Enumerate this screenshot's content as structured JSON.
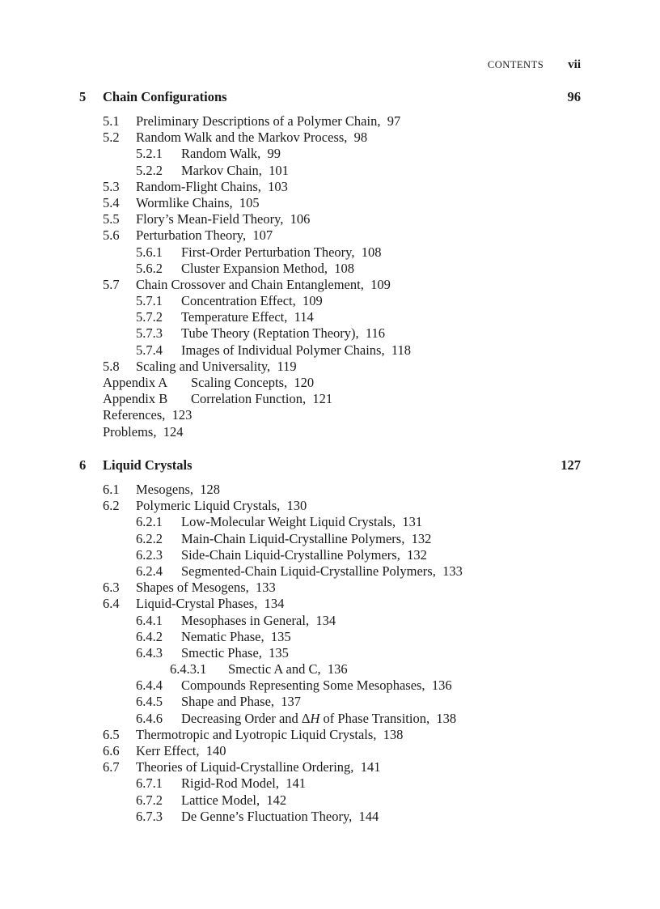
{
  "running_head": {
    "title": "CONTENTS",
    "page": "vii"
  },
  "chapters": [
    {
      "number": "5",
      "title": "Chain Configurations",
      "page": "96",
      "entries": [
        {
          "level": 1,
          "num": "5.1",
          "title": "Preliminary Descriptions of a Polymer Chain,",
          "page": "97"
        },
        {
          "level": 1,
          "num": "5.2",
          "title": "Random Walk and the Markov Process,",
          "page": "98"
        },
        {
          "level": 2,
          "num": "5.2.1",
          "title": "Random Walk,",
          "page": "99"
        },
        {
          "level": 2,
          "num": "5.2.2",
          "title": "Markov Chain,",
          "page": "101"
        },
        {
          "level": 1,
          "num": "5.3",
          "title": "Random-Flight Chains,",
          "page": "103"
        },
        {
          "level": 1,
          "num": "5.4",
          "title": "Wormlike Chains,",
          "page": "105"
        },
        {
          "level": 1,
          "num": "5.5",
          "title": "Flory’s Mean-Field Theory,",
          "page": "106"
        },
        {
          "level": 1,
          "num": "5.6",
          "title": "Perturbation Theory,",
          "page": "107"
        },
        {
          "level": 2,
          "num": "5.6.1",
          "title": "First-Order Perturbation Theory,",
          "page": "108"
        },
        {
          "level": 2,
          "num": "5.6.2",
          "title": "Cluster Expansion Method,",
          "page": "108"
        },
        {
          "level": 1,
          "num": "5.7",
          "title": "Chain Crossover and Chain Entanglement,",
          "page": "109"
        },
        {
          "level": 2,
          "num": "5.7.1",
          "title": "Concentration Effect,",
          "page": "109"
        },
        {
          "level": 2,
          "num": "5.7.2",
          "title": "Temperature Effect,",
          "page": "114"
        },
        {
          "level": 2,
          "num": "5.7.3",
          "title": "Tube Theory (Reptation Theory),",
          "page": "116"
        },
        {
          "level": 2,
          "num": "5.7.4",
          "title": "Images of Individual Polymer Chains,",
          "page": "118"
        },
        {
          "level": 1,
          "num": "5.8",
          "title": "Scaling and Universality,",
          "page": "119"
        },
        {
          "level": 0,
          "num": "Appendix A",
          "title": "Scaling Concepts,",
          "page": "120"
        },
        {
          "level": 0,
          "num": "Appendix B",
          "title": "Correlation Function,",
          "page": "121"
        },
        {
          "level": 0,
          "num": "",
          "title": "References,",
          "page": "123"
        },
        {
          "level": 0,
          "num": "",
          "title": "Problems,",
          "page": "124"
        }
      ]
    },
    {
      "number": "6",
      "title": "Liquid Crystals",
      "page": "127",
      "entries": [
        {
          "level": 1,
          "num": "6.1",
          "title": "Mesogens,",
          "page": "128"
        },
        {
          "level": 1,
          "num": "6.2",
          "title": "Polymeric Liquid Crystals,",
          "page": "130"
        },
        {
          "level": 2,
          "num": "6.2.1",
          "title": "Low-Molecular Weight Liquid Crystals,",
          "page": "131"
        },
        {
          "level": 2,
          "num": "6.2.2",
          "title": "Main-Chain Liquid-Crystalline Polymers,",
          "page": "132"
        },
        {
          "level": 2,
          "num": "6.2.3",
          "title": "Side-Chain Liquid-Crystalline Polymers,",
          "page": "132"
        },
        {
          "level": 2,
          "num": "6.2.4",
          "title": "Segmented-Chain Liquid-Crystalline Polymers,",
          "page": "133"
        },
        {
          "level": 1,
          "num": "6.3",
          "title": "Shapes of Mesogens,",
          "page": "133"
        },
        {
          "level": 1,
          "num": "6.4",
          "title": "Liquid-Crystal Phases,",
          "page": "134"
        },
        {
          "level": 2,
          "num": "6.4.1",
          "title": "Mesophases in General,",
          "page": "134"
        },
        {
          "level": 2,
          "num": "6.4.2",
          "title": "Nematic Phase,",
          "page": "135"
        },
        {
          "level": 2,
          "num": "6.4.3",
          "title": "Smectic Phase,",
          "page": "135"
        },
        {
          "level": 3,
          "num": "6.4.3.1",
          "title": "Smectic A and C,",
          "page": "136"
        },
        {
          "level": 2,
          "num": "6.4.4",
          "title": "Compounds Representing Some Mesophases,",
          "page": "136"
        },
        {
          "level": 2,
          "num": "6.4.5",
          "title": "Shape and Phase,",
          "page": "137"
        },
        {
          "level": 2,
          "num": "6.4.6",
          "title": "Decreasing Order and ΔH of Phase Transition,",
          "page": "138"
        },
        {
          "level": 1,
          "num": "6.5",
          "title": "Thermotropic and Lyotropic Liquid Crystals,",
          "page": "138"
        },
        {
          "level": 1,
          "num": "6.6",
          "title": "Kerr Effect,",
          "page": "140"
        },
        {
          "level": 1,
          "num": "6.7",
          "title": "Theories of Liquid-Crystalline Ordering,",
          "page": "141"
        },
        {
          "level": 2,
          "num": "6.7.1",
          "title": "Rigid-Rod Model,",
          "page": "141"
        },
        {
          "level": 2,
          "num": "6.7.2",
          "title": "Lattice Model,",
          "page": "142"
        },
        {
          "level": 2,
          "num": "6.7.3",
          "title": "De Genne’s Fluctuation Theory,",
          "page": "144"
        }
      ]
    }
  ]
}
